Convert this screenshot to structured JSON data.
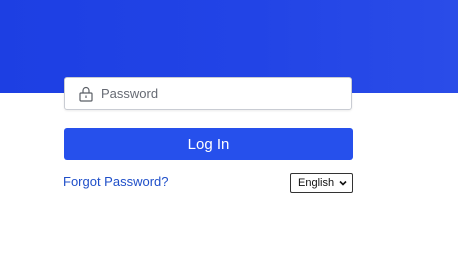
{
  "hero": {
    "color": "#1d3fe3"
  },
  "login_form": {
    "password": {
      "placeholder": "Password",
      "value": "",
      "icon": "lock-icon"
    },
    "login_button_label": "Log In",
    "login_button_color": "#2650ec",
    "forgot_password_label": "Forgot Password?",
    "forgot_password_color": "#1f4fc9",
    "language": {
      "selected": "English",
      "icon": "chevron-down-icon"
    }
  }
}
